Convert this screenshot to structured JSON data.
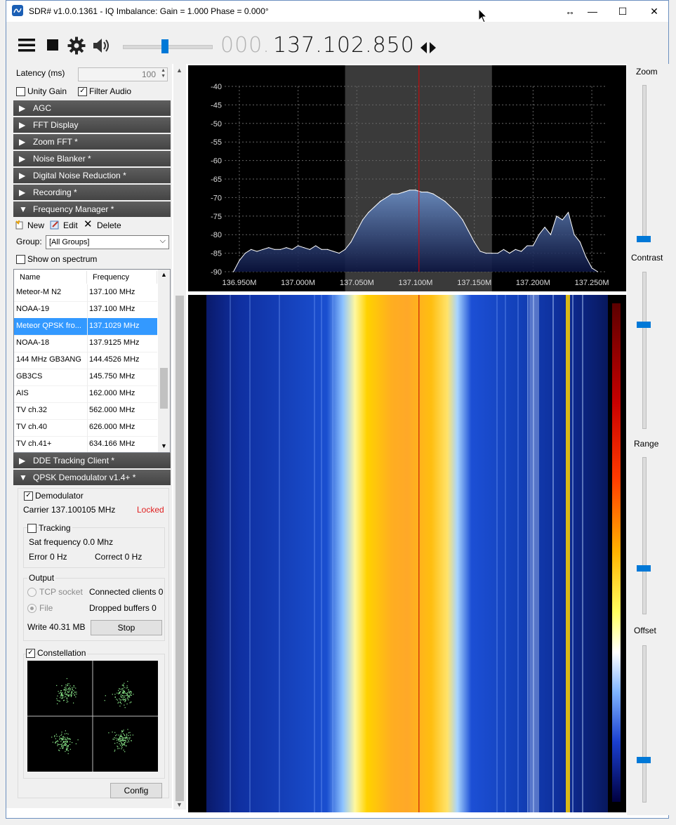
{
  "window": {
    "title": "SDR# v1.0.0.1361 - IQ Imbalance: Gain = 1.000 Phase = 0.000°",
    "buttons": {
      "resize": "↔",
      "minimize": "—",
      "maximize": "☐",
      "close": "✕"
    }
  },
  "toolbar": {
    "freq_dim": "000.",
    "freq_main": "137.102.850",
    "icons": [
      "menu-icon",
      "stop-icon",
      "gear-icon",
      "speaker-icon",
      "tune-arrows-icon"
    ],
    "volume_level": 0.5
  },
  "audio": {
    "latency_label": "Latency (ms)",
    "latency_value": "100",
    "unity_gain_label": "Unity Gain",
    "unity_gain_checked": false,
    "filter_audio_label": "Filter Audio",
    "filter_audio_checked": true
  },
  "panels": {
    "agc": "AGC",
    "fft_display": "FFT Display",
    "zoom_fft": "Zoom FFT *",
    "noise_blanker": "Noise Blanker *",
    "dnr": "Digital Noise Reduction *",
    "recording": "Recording *",
    "freq_manager": "Frequency Manager *",
    "dde": "DDE Tracking Client *",
    "qpsk": "QPSK Demodulator v1.4+ *"
  },
  "freq_manager": {
    "new_label": "New",
    "edit_label": "Edit",
    "delete_label": "Delete",
    "group_label": "Group:",
    "group_value": "[All Groups]",
    "show_on_spectrum_label": "Show on spectrum",
    "columns": [
      "Name",
      "Frequency"
    ],
    "rows": [
      {
        "name": "Meteor-M N2",
        "freq": "137.100 MHz"
      },
      {
        "name": "NOAA-19",
        "freq": "137.100 MHz"
      },
      {
        "name": "Meteor QPSK fro...",
        "freq": "137.1029 MHz"
      },
      {
        "name": "NOAA-18",
        "freq": "137.9125 MHz"
      },
      {
        "name": "144 MHz GB3ANG",
        "freq": "144.4526 MHz"
      },
      {
        "name": "GB3CS",
        "freq": "145.750 MHz"
      },
      {
        "name": "AIS",
        "freq": "162.000 MHz"
      },
      {
        "name": "TV ch.32",
        "freq": "562.000 MHz"
      },
      {
        "name": "TV ch.40",
        "freq": "626.000 MHz"
      },
      {
        "name": "TV ch.41+",
        "freq": "634.166 MHz"
      }
    ],
    "selected_index": 2
  },
  "qpsk": {
    "demodulator_label": "Demodulator",
    "carrier_text": "Carrier 137.100105 MHz",
    "status": "Locked",
    "status_color": "#e02020",
    "tracking_label": "Tracking",
    "sat_frequency": "Sat frequency 0.0 Mhz",
    "error": "Error 0 Hz",
    "correct": "Correct 0 Hz",
    "output_label": "Output",
    "tcp_socket_label": "TCP socket",
    "connected_clients": "Connected clients 0",
    "file_label": "File",
    "dropped_buffers": "Dropped buffers 0",
    "write_text": "Write 40.31 MB",
    "stop_label": "Stop",
    "constellation_label": "Constellation",
    "config_label": "Config"
  },
  "sliders": {
    "zoom_label": "Zoom",
    "contrast_label": "Contrast",
    "range_label": "Range",
    "offset_label": "Offset",
    "accent_color": "#0078d7"
  },
  "chart_data": {
    "type": "line",
    "title": "",
    "xlabel": "",
    "ylabel": "",
    "y_ticks": [
      "-40",
      "-45",
      "-50",
      "-55",
      "-60",
      "-65",
      "-70",
      "-75",
      "-80",
      "-85",
      "-90"
    ],
    "x_ticks": [
      "136.950M",
      "137.000M",
      "137.050M",
      "137.100M",
      "137.150M",
      "137.200M",
      "137.250M"
    ],
    "ylim": [
      -90,
      -40
    ],
    "xlim": [
      136.9375,
      137.2625
    ],
    "center_freq": 137.1029,
    "filter_band": [
      137.04,
      137.165
    ],
    "grid": true,
    "x": [
      136.945,
      136.95,
      136.955,
      136.96,
      136.965,
      136.97,
      136.975,
      136.98,
      136.985,
      136.99,
      136.995,
      137.0,
      137.005,
      137.01,
      137.015,
      137.02,
      137.025,
      137.03,
      137.035,
      137.04,
      137.045,
      137.05,
      137.055,
      137.06,
      137.065,
      137.07,
      137.075,
      137.08,
      137.085,
      137.09,
      137.095,
      137.1,
      137.105,
      137.11,
      137.115,
      137.12,
      137.125,
      137.13,
      137.135,
      137.14,
      137.145,
      137.15,
      137.155,
      137.16,
      137.165,
      137.17,
      137.175,
      137.18,
      137.185,
      137.19,
      137.195,
      137.2,
      137.205,
      137.21,
      137.215,
      137.22,
      137.225,
      137.23,
      137.235,
      137.24,
      137.245,
      137.25,
      137.255
    ],
    "y": [
      -90,
      -87,
      -85,
      -84,
      -84.5,
      -84,
      -83.5,
      -84,
      -84,
      -83.5,
      -84,
      -83,
      -83.5,
      -84,
      -83,
      -84,
      -84,
      -84.5,
      -85,
      -84,
      -82,
      -79,
      -76,
      -74,
      -72.5,
      -71,
      -70,
      -69,
      -69,
      -68.5,
      -68,
      -68,
      -68.5,
      -68.5,
      -69,
      -70,
      -71,
      -72.5,
      -74,
      -76,
      -79,
      -82,
      -84.5,
      -85,
      -85,
      -85,
      -84,
      -85,
      -84,
      -84.5,
      -83,
      -83,
      -80,
      -78,
      -80,
      -75,
      -76,
      -74,
      -80,
      -82,
      -86,
      -89,
      -90
    ]
  }
}
